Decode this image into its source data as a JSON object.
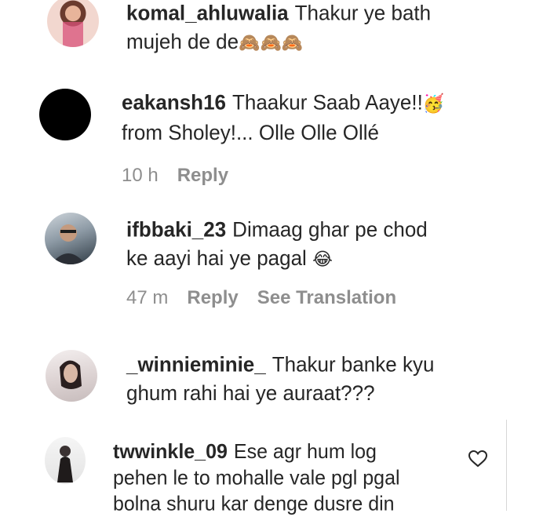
{
  "comments": [
    {
      "username": "komal_ahluwalia",
      "text_line1": "Thakur ye bath",
      "text_line2": "mujeh de de",
      "emoji": "🙈🙈🙈"
    },
    {
      "username": "eakansh16",
      "text_line1": "Thaakur Saab Aaye!!",
      "emoji": "🥳",
      "text_line2": "from Sholey!... Olle Olle Ollé",
      "time": "10 h",
      "reply": "Reply"
    },
    {
      "username": "ifbbaki_23",
      "text_line1": "Dimaag ghar pe chod",
      "text_line2": "ke aayi hai ye pagal",
      "emoji": "😂",
      "time": "47 m",
      "reply": "Reply",
      "translate": "See Translation"
    },
    {
      "username": "_winnieminie_",
      "text_line1": "Thakur banke kyu",
      "text_line2": "ghum rahi hai ye auraat???"
    },
    {
      "username": "twwinkle_09",
      "text_line1": "Ese agr hum log",
      "text_line2": "pehen le to mohalle vale pgl pgal",
      "text_line3": "bolna shuru kar denge dusre din"
    }
  ],
  "icons": {
    "like": "heart-icon"
  }
}
